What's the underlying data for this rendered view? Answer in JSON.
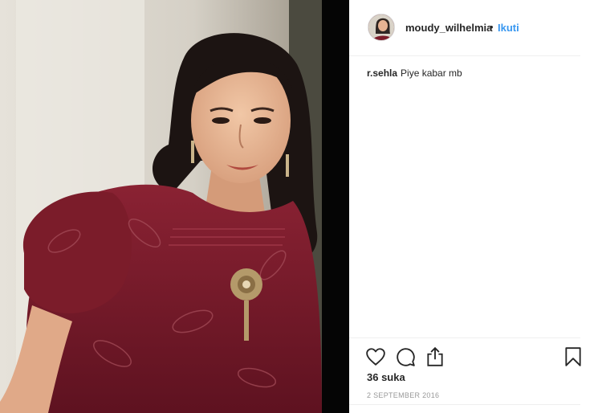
{
  "post": {
    "username": "moudy_wilhelmia",
    "separator": "•",
    "follow_label": "Ikuti",
    "comments": [
      {
        "user": "r.sehla",
        "text": "Piye kabar mb"
      }
    ],
    "likes_text": "36 suka",
    "date_text": "2 SEPTEMBER 2016"
  },
  "icons": {
    "like": "heart-icon",
    "comment": "comment-icon",
    "share": "share-icon",
    "save": "bookmark-icon"
  },
  "colors": {
    "follow": "#3897f0",
    "text": "#262626",
    "muted": "#999999",
    "dress": "#7b1c2a"
  }
}
